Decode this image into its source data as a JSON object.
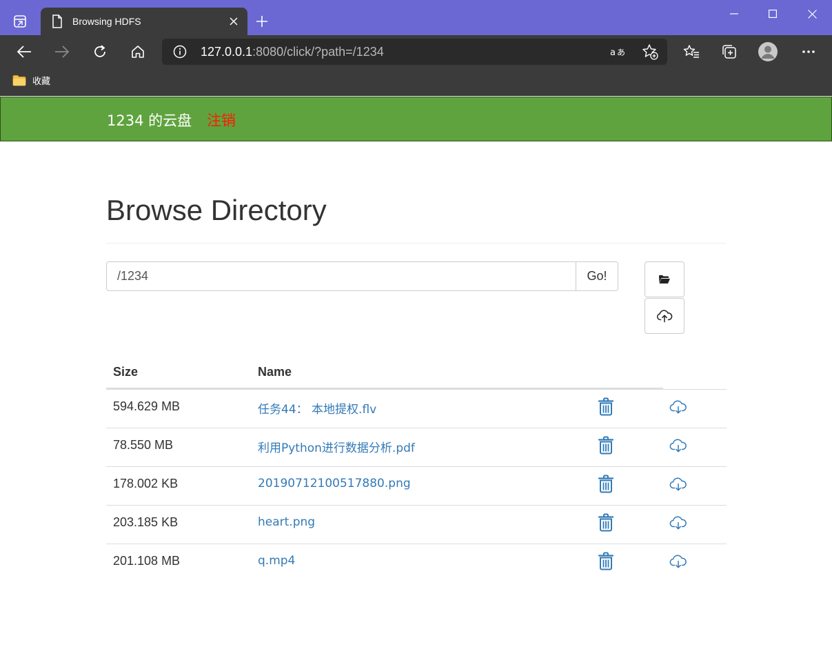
{
  "browser": {
    "tab_title": "Browsing HDFS",
    "url_host": "127.0.0.1",
    "url_rest": ":8080/click/?path=/1234",
    "favorites_label": "收藏"
  },
  "header": {
    "user_label": "1234 的云盘",
    "logout_label": "注销"
  },
  "main": {
    "heading": "Browse Directory",
    "path_value": "/1234",
    "go_label": "Go!",
    "columns": {
      "size": "Size",
      "name": "Name"
    },
    "files": [
      {
        "size": "594.629 MB",
        "name": "任务44： 本地提权.flv"
      },
      {
        "size": "78.550 MB",
        "name": "利用Python进行数据分析.pdf"
      },
      {
        "size": "178.002 KB",
        "name": "20190712100517880.png"
      },
      {
        "size": "203.185 KB",
        "name": "heart.png"
      },
      {
        "size": "201.108 MB",
        "name": "q.mp4"
      }
    ]
  },
  "colors": {
    "header_bg": "#5fa33f",
    "logout": "#ff1a00",
    "link": "#337ab7",
    "titlebar": "#6b68d4"
  }
}
